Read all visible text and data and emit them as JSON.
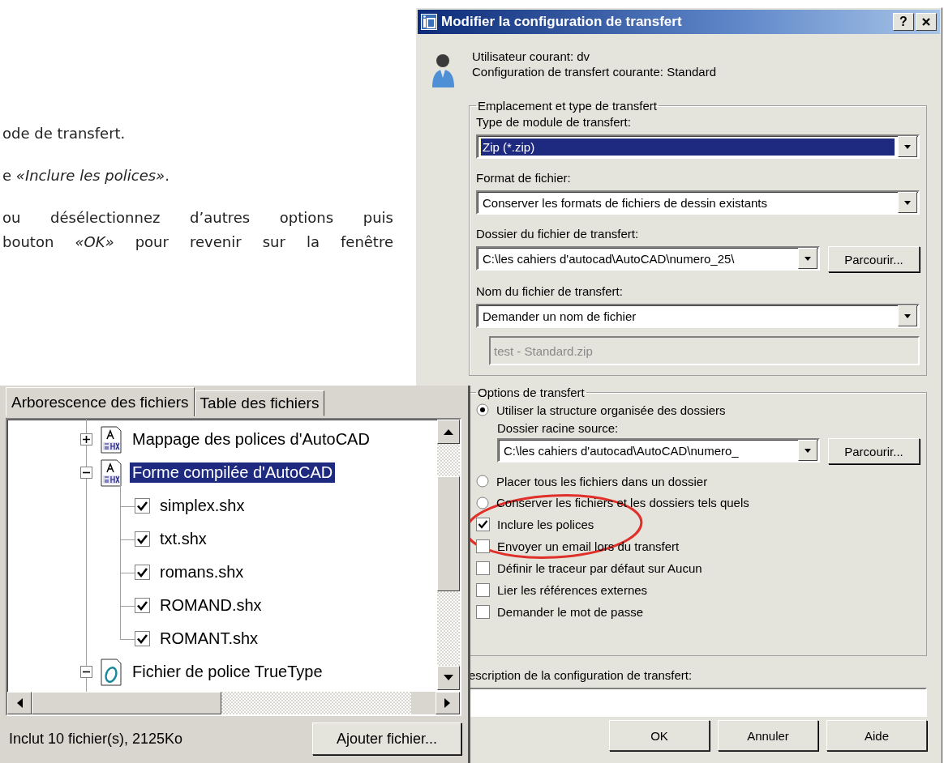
{
  "article": {
    "paragraphs": [
      [
        "ode de transfert."
      ],
      [
        "e *«Inclure les polices»*."
      ],
      [
        "ou désélectionnez d’autres options puis",
        "bouton *«OK»* pour revenir sur la fenêtre"
      ]
    ]
  },
  "dialog": {
    "title": "Modifier la configuration de transfert",
    "help_button": "?",
    "user_line": "Utilisateur courant: dv",
    "config_line": "Configuration de transfert courante: Standard",
    "location_group": {
      "legend": "Emplacement et type de transfert",
      "fields": [
        {
          "label": "Type de module de transfert:",
          "value": "Zip (*.zip)",
          "focused": true
        },
        {
          "label": "Format de fichier:",
          "value": "Conserver les formats de fichiers de dessin existants",
          "focused": false
        },
        {
          "label": "Dossier du fichier de transfert:",
          "value": "C:\\les cahiers d'autocad\\AutoCAD\\numero_25\\",
          "focused": false,
          "browse": "Parcourir..."
        },
        {
          "label": "Nom du fichier de transfert:",
          "value": "Demander un nom de fichier",
          "focused": false
        }
      ],
      "file_name": {
        "value": "test - Standard.zip",
        "disabled": true
      }
    },
    "options_group": {
      "legend": "Options de transfert",
      "options": [
        {
          "kind": "radio",
          "label": "Utiliser la structure organisée des dossiers",
          "selected": true,
          "source": {
            "label": "Dossier racine source:",
            "value": "C:\\les cahiers d'autocad\\AutoCAD\\numero_",
            "browse": "Parcourir..."
          }
        },
        {
          "kind": "radio",
          "label": "Placer tous les fichiers dans un dossier",
          "selected": false
        },
        {
          "kind": "radio",
          "label": "Conserver les fichiers et les dossiers tels quels",
          "selected": false
        },
        {
          "kind": "checkbox",
          "label": "Inclure les polices",
          "checked": true
        },
        {
          "kind": "checkbox",
          "label": "Envoyer un email lors du transfert",
          "checked": false
        },
        {
          "kind": "checkbox",
          "label": "Définir le traceur par défaut sur Aucun",
          "checked": false
        },
        {
          "kind": "checkbox",
          "label": "Lier les références externes",
          "checked": false
        },
        {
          "kind": "checkbox",
          "label": "Demander le mot de passe",
          "checked": false
        }
      ]
    },
    "description": {
      "label": "escription de la configuration de transfert:"
    },
    "buttons": [
      "OK",
      "Annuler",
      "Aide"
    ],
    "annotation": {
      "kind": "ellipse"
    }
  },
  "file_panel": {
    "tabs": [
      {
        "label": "Arborescence des fichiers",
        "selected": true
      },
      {
        "label": "Table des fichiers",
        "selected": false
      }
    ],
    "tree": [
      {
        "label": "Mappage des polices d'AutoCAD",
        "kind": "shx",
        "expanded": false,
        "selected": false
      },
      {
        "label": "Forme compilée d'AutoCAD",
        "kind": "shx",
        "expanded": true,
        "selected": true,
        "children": [
          {
            "label": "simplex.shx",
            "checked": true
          },
          {
            "label": "txt.shx",
            "checked": true
          },
          {
            "label": "romans.shx",
            "checked": true
          },
          {
            "label": "ROMAND.shx",
            "checked": true
          },
          {
            "label": "ROMANT.shx",
            "checked": true
          }
        ]
      },
      {
        "label": "Fichier de police TrueType",
        "kind": "truetype",
        "expanded": true,
        "selected": false
      }
    ],
    "status": "Inclut 10 fichier(s), 2125Ko",
    "button": "Ajouter fichier..."
  }
}
